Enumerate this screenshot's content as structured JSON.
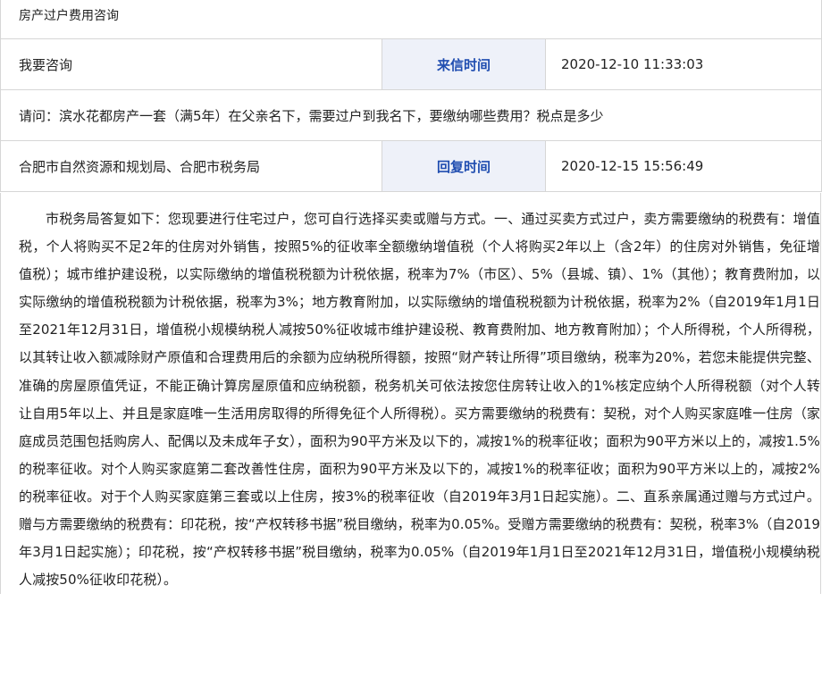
{
  "title": "房产过户费用咨询",
  "inquiry": {
    "label": "我要咨询",
    "time_label": "来信时间",
    "time": "2020-12-10 11:33:03"
  },
  "question": "请问：滨水花都房产一套（满5年）在父亲名下，需要过户到我名下，要缴纳哪些费用？税点是多少",
  "reply": {
    "department": "合肥市自然资源和规划局、合肥市税务局",
    "time_label": "回复时间",
    "time": "2020-12-15 15:56:49"
  },
  "answer": "市税务局答复如下：您现要进行住宅过户，您可自行选择买卖或赠与方式。一、通过买卖方式过户，卖方需要缴纳的税费有：增值税，个人将购买不足2年的住房对外销售，按照5%的征收率全额缴纳增值税（个人将购买2年以上（含2年）的住房对外销售，免征增值税）；城市维护建设税，以实际缴纳的增值税税额为计税依据，税率为7%（市区）、5%（县城、镇）、1%（其他）；教育费附加，以实际缴纳的增值税税额为计税依据，税率为3%；地方教育附加，以实际缴纳的增值税税额为计税依据，税率为2%（自2019年1月1日至2021年12月31日，增值税小规模纳税人减按50%征收城市维护建设税、教育费附加、地方教育附加）；个人所得税，个人所得税，以其转让收入额减除财产原值和合理费用后的余额为应纳税所得额，按照“财产转让所得”项目缴纳，税率为20%，若您未能提供完整、准确的房屋原值凭证，不能正确计算房屋原值和应纳税额，税务机关可依法按您住房转让收入的1%核定应纳个人所得税额（对个人转让自用5年以上、并且是家庭唯一生活用房取得的所得免征个人所得税）。买方需要缴纳的税费有：契税，对个人购买家庭唯一住房（家庭成员范围包括购房人、配偶以及未成年子女），面积为90平方米及以下的，减按1%的税率征收；面积为90平方米以上的，减按1.5%的税率征收。对个人购买家庭第二套改善性住房，面积为90平方米及以下的，减按1%的税率征收；面积为90平方米以上的，减按2%的税率征收。对于个人购买家庭第三套或以上住房，按3%的税率征收（自2019年3月1日起实施）。二、直系亲属通过赠与方式过户。赠与方需要缴纳的税费有：印花税，按“产权转移书据”税目缴纳，税率为0.05%。受赠方需要缴纳的税费有：契税，税率3%（自2019年3月1日起实施）；印花税，按“产权转移书据”税目缴纳，税率为0.05%（自2019年1月1日至2021年12月31日，增值税小规模纳税人减按50%征收印花税）。"
}
